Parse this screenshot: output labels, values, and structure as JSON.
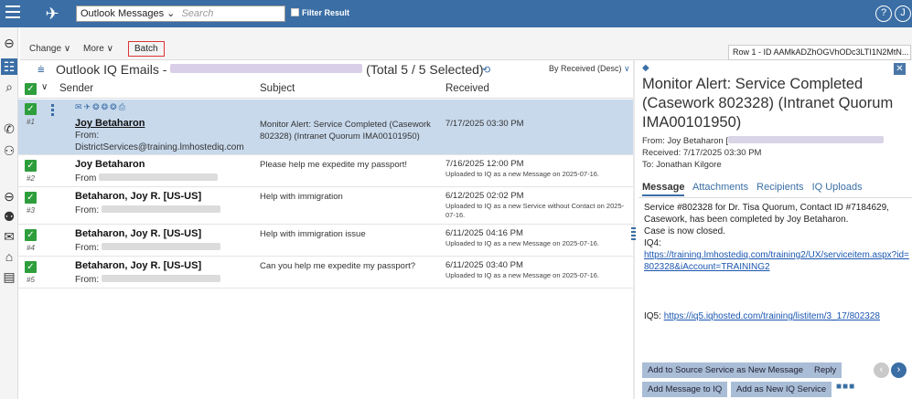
{
  "topbar": {
    "view_select": "Outlook Messages",
    "search_placeholder": "Search",
    "filter_label": "Filter Result",
    "help_label": "?",
    "user_initial": "J"
  },
  "toolbar": {
    "change_label": "Change",
    "more_label": "More",
    "batch_label": "Batch",
    "row_info": "Row 1 - ID AAMkADZhOGVhODc3LTI1N2MtN..."
  },
  "list": {
    "title_prefix": "Outlook IQ Emails -",
    "title_suffix": "(Total 5 / 5 Selected)",
    "sort_label": "By Received (Desc)",
    "columns": {
      "sender": "Sender",
      "subject": "Subject",
      "received": "Received"
    },
    "rows": [
      {
        "num": "#1",
        "sender": "Joy Betaharon",
        "from": "From: DistrictServices@training.lmhostediq.com",
        "subject": "Monitor Alert: Service Completed (Casework 802328) (Intranet Quorum IMA00101950)",
        "received": "7/17/2025 03:30 PM",
        "note": ""
      },
      {
        "num": "#2",
        "sender": "Joy Betaharon",
        "from": "From",
        "subject": "Please help me expedite my passport!",
        "received": "7/16/2025 12:00 PM",
        "note": "Uploaded to IQ as a new Message on 2025-07-16."
      },
      {
        "num": "#3",
        "sender": "Betaharon, Joy R. [US-US]",
        "from": "From:",
        "subject": "Help with immigration",
        "received": "6/12/2025 02:02 PM",
        "note": "Uploaded to IQ as a new Service without Contact on 2025-07-16."
      },
      {
        "num": "#4",
        "sender": "Betaharon, Joy R. [US-US]",
        "from": "From:",
        "subject": "Help with immigration issue",
        "received": "6/11/2025 04:16 PM",
        "note": "Uploaded to IQ as a new Message on 2025-07-16."
      },
      {
        "num": "#5",
        "sender": "Betaharon, Joy R. [US-US]",
        "from": "From:",
        "subject": "Can you help me expedite my passport?",
        "received": "6/11/2025 03:40 PM",
        "note": "Uploaded to IQ as a new Message on 2025-07-16."
      }
    ]
  },
  "detail": {
    "title": "Monitor Alert: Service Completed (Casework 802328) (Intranet Quorum IMA00101950)",
    "from": "From: Joy Betaharon [",
    "received": "Received: 7/17/2025 03:30 PM",
    "to": "To: Jonathan Kilgore",
    "tabs": [
      "Message",
      "Attachments",
      "Recipients",
      "IQ Uploads"
    ],
    "body_line1": "Service #802328 for Dr. Tisa Quorum, Contact ID #7184629, Casework, has been completed by Joy Betaharon.",
    "body_line2": "Case is now closed.",
    "iq4_label": "IQ4:",
    "iq4_link": "https://training.lmhostediq.com/training2/UX/serviceitem.aspx?id=802328&iAccount=TRAINING2",
    "iq5_label": "IQ5:",
    "iq5_link": "https://iq5.iqhosted.com/training/listitem/3_17/802328",
    "buttons": {
      "add_source": "Add to Source Service as New Message",
      "reply": "Reply",
      "add_message": "Add Message to IQ",
      "add_service": "Add as New IQ Service"
    }
  },
  "colors": {
    "accent": "#3a6ea5",
    "selected_row": "#c8d9ec",
    "check": "#2e9e3c",
    "button": "#a9bdd6"
  }
}
